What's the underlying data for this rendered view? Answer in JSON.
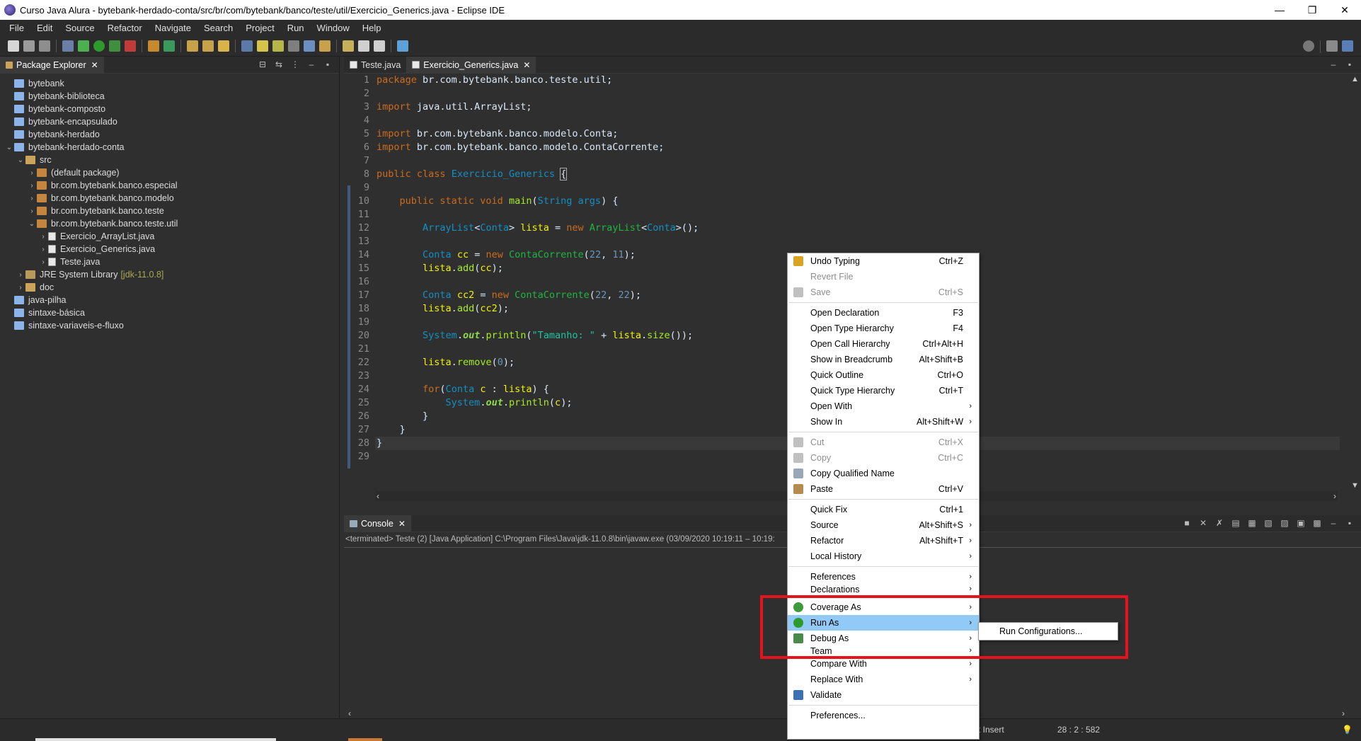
{
  "window": {
    "title": "Curso Java Alura - bytebank-herdado-conta/src/br/com/bytebank/banco/teste/util/Exercicio_Generics.java - Eclipse IDE",
    "minimize": "—",
    "restore": "❐",
    "close": "✕"
  },
  "menubar": [
    "File",
    "Edit",
    "Source",
    "Refactor",
    "Navigate",
    "Search",
    "Project",
    "Run",
    "Window",
    "Help"
  ],
  "package_explorer": {
    "title": "Package Explorer",
    "close": "✕",
    "items": [
      {
        "label": "bytebank",
        "depth": 0,
        "arrow": "",
        "icon": "proj"
      },
      {
        "label": "bytebank-biblioteca",
        "depth": 0,
        "arrow": "",
        "icon": "proj"
      },
      {
        "label": "bytebank-composto",
        "depth": 0,
        "arrow": "",
        "icon": "proj"
      },
      {
        "label": "bytebank-encapsulado",
        "depth": 0,
        "arrow": "",
        "icon": "proj"
      },
      {
        "label": "bytebank-herdado",
        "depth": 0,
        "arrow": "",
        "icon": "proj"
      },
      {
        "label": "bytebank-herdado-conta",
        "depth": 0,
        "arrow": "⌄",
        "icon": "proj"
      },
      {
        "label": "src",
        "depth": 1,
        "arrow": "⌄",
        "icon": "folder"
      },
      {
        "label": "(default package)",
        "depth": 2,
        "arrow": "›",
        "icon": "pkg"
      },
      {
        "label": "br.com.bytebank.banco.especial",
        "depth": 2,
        "arrow": "›",
        "icon": "pkg"
      },
      {
        "label": "br.com.bytebank.banco.modelo",
        "depth": 2,
        "arrow": "›",
        "icon": "pkg"
      },
      {
        "label": "br.com.bytebank.banco.teste",
        "depth": 2,
        "arrow": "›",
        "icon": "pkg"
      },
      {
        "label": "br.com.bytebank.banco.teste.util",
        "depth": 2,
        "arrow": "⌄",
        "icon": "pkg"
      },
      {
        "label": "Exercicio_ArrayList.java",
        "depth": 3,
        "arrow": "›",
        "icon": "java"
      },
      {
        "label": "Exercicio_Generics.java",
        "depth": 3,
        "arrow": "›",
        "icon": "java"
      },
      {
        "label": "Teste.java",
        "depth": 3,
        "arrow": "›",
        "icon": "java"
      },
      {
        "label": "JRE System Library",
        "depth": 1,
        "arrow": "›",
        "icon": "lib",
        "extra": "[jdk-11.0.8]"
      },
      {
        "label": "doc",
        "depth": 1,
        "arrow": "›",
        "icon": "folder"
      },
      {
        "label": "java-pilha",
        "depth": 0,
        "arrow": "",
        "icon": "proj"
      },
      {
        "label": "sintaxe-básica",
        "depth": 0,
        "arrow": "",
        "icon": "proj"
      },
      {
        "label": "sintaxe-variaveis-e-fluxo",
        "depth": 0,
        "arrow": "",
        "icon": "proj"
      }
    ]
  },
  "editor": {
    "tabs": [
      {
        "label": "Teste.java",
        "active": false
      },
      {
        "label": "Exercicio_Generics.java",
        "active": true
      }
    ],
    "close": "✕",
    "line_numbers": [
      "1",
      "2",
      "3",
      "4",
      "5",
      "6",
      "7",
      "8",
      "9",
      "10",
      "11",
      "12",
      "13",
      "14",
      "15",
      "16",
      "17",
      "18",
      "19",
      "20",
      "21",
      "22",
      "23",
      "24",
      "25",
      "26",
      "27",
      "28",
      "29"
    ],
    "current_line": 28
  },
  "console": {
    "title": "Console",
    "close": "✕",
    "status": "<terminated> Teste (2) [Java Application] C:\\Program Files\\Java\\jdk-11.0.8\\bin\\javaw.exe  (03/09/2020 10:19:11 – 10:19:"
  },
  "statusbar": {
    "insert": "rt Insert",
    "position": "28 : 2 : 582"
  },
  "context_menu": {
    "items": [
      {
        "type": "item",
        "label": "Undo Typing",
        "shortcut": "Ctrl+Z",
        "icon": "undo-icon",
        "color": "#d9a520"
      },
      {
        "type": "item",
        "label": "Revert File",
        "shortcut": "",
        "disabled": true
      },
      {
        "type": "item",
        "label": "Save",
        "shortcut": "Ctrl+S",
        "disabled": true,
        "icon": "save-icon",
        "color": "#c0c0c0"
      },
      {
        "type": "sep"
      },
      {
        "type": "item",
        "label": "Open Declaration",
        "shortcut": "F3"
      },
      {
        "type": "item",
        "label": "Open Type Hierarchy",
        "shortcut": "F4"
      },
      {
        "type": "item",
        "label": "Open Call Hierarchy",
        "shortcut": "Ctrl+Alt+H"
      },
      {
        "type": "item",
        "label": "Show in Breadcrumb",
        "shortcut": "Alt+Shift+B"
      },
      {
        "type": "item",
        "label": "Quick Outline",
        "shortcut": "Ctrl+O"
      },
      {
        "type": "item",
        "label": "Quick Type Hierarchy",
        "shortcut": "Ctrl+T"
      },
      {
        "type": "item",
        "label": "Open With",
        "shortcut": "",
        "sub": true
      },
      {
        "type": "item",
        "label": "Show In",
        "shortcut": "Alt+Shift+W",
        "sub": true
      },
      {
        "type": "sep"
      },
      {
        "type": "item",
        "label": "Cut",
        "shortcut": "Ctrl+X",
        "disabled": true,
        "icon": "cut-icon",
        "color": "#c0c0c0"
      },
      {
        "type": "item",
        "label": "Copy",
        "shortcut": "Ctrl+C",
        "disabled": true,
        "icon": "copy-icon",
        "color": "#c0c0c0"
      },
      {
        "type": "item",
        "label": "Copy Qualified Name",
        "shortcut": "",
        "icon": "copy-qualified-icon",
        "color": "#9aa7b8"
      },
      {
        "type": "item",
        "label": "Paste",
        "shortcut": "Ctrl+V",
        "icon": "paste-icon",
        "color": "#b58a4c"
      },
      {
        "type": "sep"
      },
      {
        "type": "item",
        "label": "Quick Fix",
        "shortcut": "Ctrl+1"
      },
      {
        "type": "item",
        "label": "Source",
        "shortcut": "Alt+Shift+S",
        "sub": true
      },
      {
        "type": "item",
        "label": "Refactor",
        "shortcut": "Alt+Shift+T",
        "sub": true
      },
      {
        "type": "item",
        "label": "Local History",
        "shortcut": "",
        "sub": true
      },
      {
        "type": "sep"
      },
      {
        "type": "item",
        "label": "References",
        "shortcut": "",
        "sub": true
      },
      {
        "type": "item",
        "label": "Declarations",
        "shortcut": "",
        "sub": true,
        "clipped": true
      },
      {
        "type": "sep"
      },
      {
        "type": "item",
        "label": "Coverage As",
        "shortcut": "",
        "sub": true,
        "icon": "coverage-icon",
        "color": "#3d9a3d"
      },
      {
        "type": "item",
        "label": "Run As",
        "shortcut": "",
        "sub": true,
        "icon": "run-icon",
        "color": "#2e9a2e",
        "highlighted": true
      },
      {
        "type": "item",
        "label": "Debug As",
        "shortcut": "",
        "sub": true,
        "icon": "debug-icon",
        "color": "#4a8a4a"
      },
      {
        "type": "item",
        "label": "Team",
        "shortcut": "",
        "sub": true,
        "clipped": true
      },
      {
        "type": "item",
        "label": "Compare With",
        "shortcut": "",
        "sub": true
      },
      {
        "type": "item",
        "label": "Replace With",
        "shortcut": "",
        "sub": true
      },
      {
        "type": "item",
        "label": "Validate",
        "shortcut": "",
        "icon": "check-icon",
        "color": "#3b6fb6"
      },
      {
        "type": "sep"
      },
      {
        "type": "item",
        "label": "Preferences...",
        "shortcut": ""
      }
    ]
  },
  "submenu": {
    "label": "Run Configurations..."
  },
  "colors": {
    "highlight_box": "#e5141c",
    "menu_highlight": "#91c9f7"
  }
}
